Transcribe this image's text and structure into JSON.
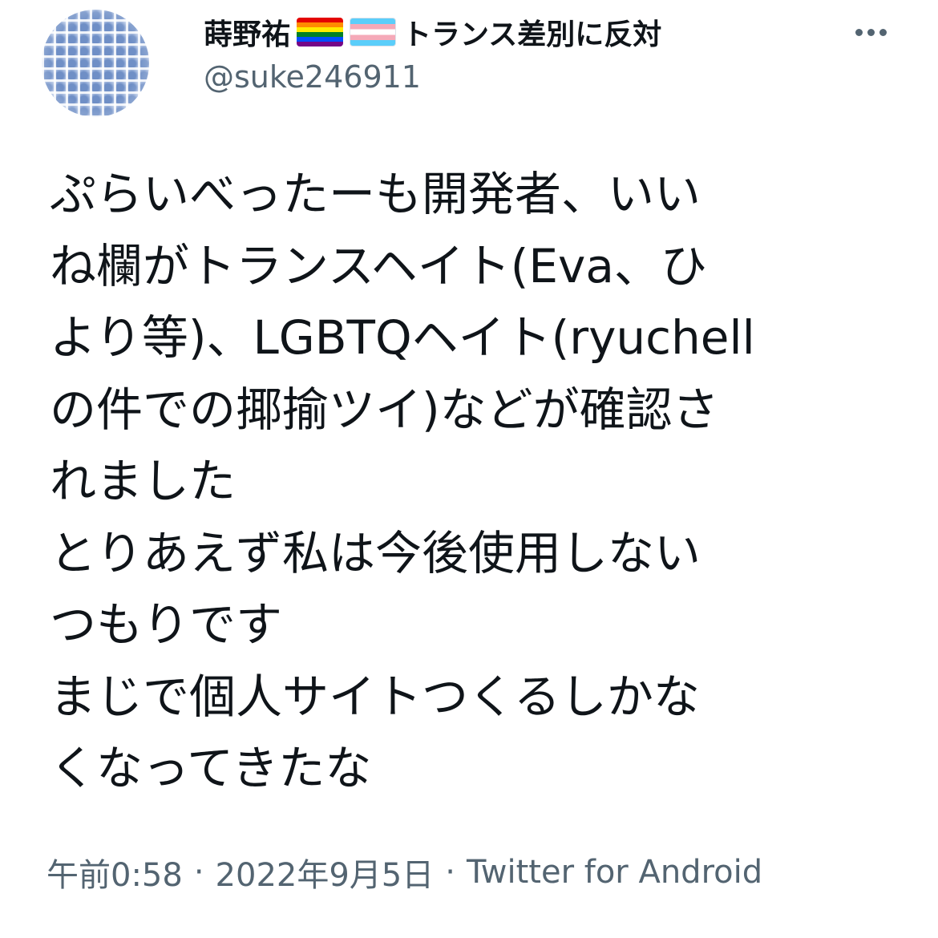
{
  "author": {
    "display_name": "蒔野祐",
    "name_suffix": "トランス差別に反対",
    "handle": "@suke246911",
    "flags": [
      "rainbow-flag-icon",
      "transgender-flag-icon"
    ]
  },
  "tweet": {
    "lines": [
      "ぷらいべったーも開発者、いい",
      "ね欄がトランスヘイト(Eva、ひ",
      "より等)、LGBTQヘイト(ryuchell",
      "の件での揶揄ツイ)などが確認さ",
      "れました",
      "とりあえず私は今後使用しない",
      "つもりです",
      "まじで個人サイトつくるしかな",
      "くなってきたな"
    ]
  },
  "meta": {
    "time": "午前0:58",
    "separator": "·",
    "date": "2022年9月5日",
    "source": "Twitter for Android"
  },
  "icons": {
    "more": "more-options-icon",
    "avatar": "avatar"
  },
  "colors": {
    "text_primary": "#0f1419",
    "text_secondary": "#536471",
    "background": "#ffffff"
  }
}
